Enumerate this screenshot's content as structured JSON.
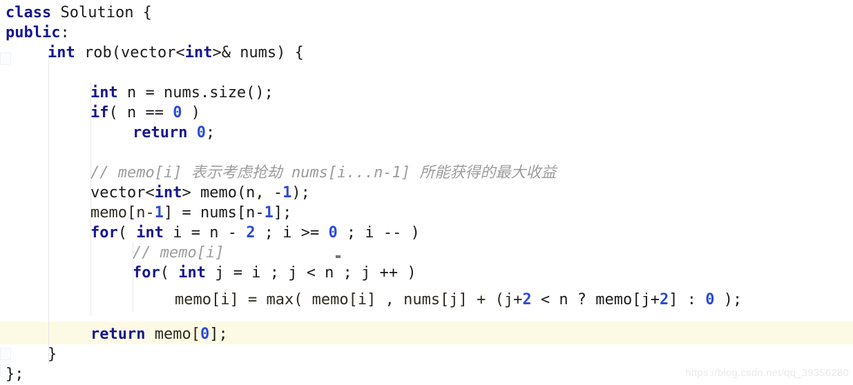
{
  "editor": {
    "language": "cpp",
    "background": "#ffffff",
    "current_line_highlight_color": "#fcfae4",
    "colors": {
      "keyword": "#171791",
      "number": "#2b4ad8",
      "comment": "#9c9c9c",
      "plain": "#1b1b1b",
      "indent_guide": "#e6e6e6"
    }
  },
  "code": {
    "line_01": "class Solution {",
    "line_01_kw": "class",
    "line_01_rest": " Solution {",
    "line_02_kw": "public",
    "line_02_rest": ":",
    "line_03_kw": "int",
    "line_03_a": " rob(vector<",
    "line_03_kw2": "int",
    "line_03_b": ">& nums) {",
    "line_04_kw": "int",
    "line_04_rest": " n = nums.size();",
    "line_05_kw": "if",
    "line_05_a": "( n == ",
    "line_05_num": "0",
    "line_05_b": " )",
    "line_06_kw": "return",
    "line_06_a": " ",
    "line_06_num": "0",
    "line_06_b": ";",
    "line_07_comment": "// memo[i] 表示考虑抢劫 nums[i...n-1] 所能获得的最大收益",
    "line_08_a": "vector<",
    "line_08_kw": "int",
    "line_08_b": "> memo(n, -",
    "line_08_num": "1",
    "line_08_c": ");",
    "line_09_a": "memo[n-",
    "line_09_num": "1",
    "line_09_b": "] = nums[n-",
    "line_09_num2": "1",
    "line_09_c": "];",
    "line_10_kw": "for",
    "line_10_a": "( ",
    "line_10_kw2": "int",
    "line_10_b": " i = n - ",
    "line_10_num": "2",
    "line_10_c": " ; i >= ",
    "line_10_num2": "0",
    "line_10_d": " ; i -- )",
    "line_11_comment": "// memo[i]",
    "line_12_kw": "for",
    "line_12_a": "( ",
    "line_12_kw2": "int",
    "line_12_b": " j = i ; j < n ; j ++ )",
    "line_13_a": "memo[i] = max( memo[i] , nums[j] + (j+",
    "line_13_num": "2",
    "line_13_b": " < n ? memo[j+",
    "line_13_num2": "2",
    "line_13_c": "] : ",
    "line_13_num3": "0",
    "line_13_d": " );",
    "line_14_kw": "return",
    "line_14_rest": " memo[0];",
    "line_14_a": " memo[",
    "line_14_num": "0",
    "line_14_b": "];",
    "line_15": "}",
    "line_16": "};"
  },
  "watermark": {
    "text": "https://blog.csdn.net/qq_39356280"
  }
}
